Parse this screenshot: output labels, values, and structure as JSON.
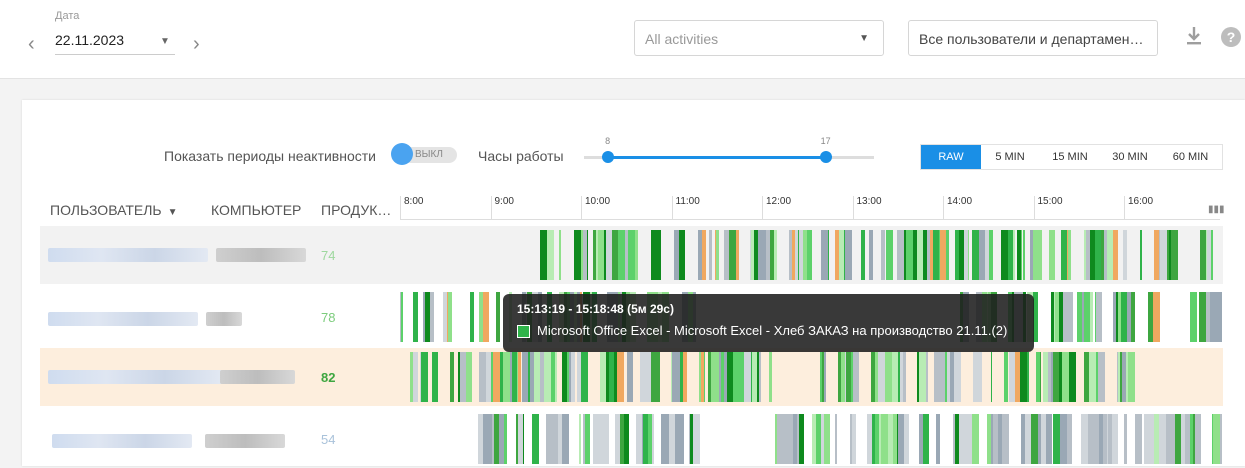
{
  "date": {
    "label": "Дата",
    "value": "22.11.2023",
    "prev_icon": "chevron-left-icon",
    "next_icon": "chevron-right-icon"
  },
  "filters": {
    "activities": "All activities",
    "users": "Все пользователи и департамен…"
  },
  "toolbar": {
    "download_icon": "download-icon",
    "help_icon": "help-icon",
    "help_glyph": "?"
  },
  "controls": {
    "inactivity_label": "Показать периоды неактивности",
    "inactivity_toggle": "ВЫКЛ",
    "work_hours_label": "Часы работы",
    "work_hours_start": "8",
    "work_hours_end": "17",
    "work_hours_min": 7,
    "work_hours_max": 19,
    "intervals": [
      "RAW",
      "5 MIN",
      "15 MIN",
      "30 MIN",
      "60 MIN"
    ],
    "active_interval": "RAW"
  },
  "table": {
    "columns": {
      "user": "ПОЛЬЗОВАТЕЛЬ",
      "computer": "КОМПЬЮТЕР",
      "productivity": "ПРОДУК…"
    },
    "hours": [
      "8:00",
      "9:00",
      "10:00",
      "11:00",
      "12:00",
      "13:00",
      "14:00",
      "15:00",
      "16:00"
    ],
    "rows": [
      {
        "productivity": "74",
        "color": "#9ed89e"
      },
      {
        "productivity": "78",
        "color": "#7ccc7c"
      },
      {
        "productivity": "82",
        "color": "#3ea640"
      },
      {
        "productivity": "54",
        "color": "#a9c2da"
      }
    ]
  },
  "tooltip": {
    "title": "15:13:19 - 15:18:48 (5м 29с)",
    "text": "Microsoft Office Excel - Microsoft Excel - Хлеб ЗАКАЗ на производство 21.11.(2)"
  },
  "colors": {
    "accent": "#1a8fe6",
    "productive_dark": "#0e8a1e",
    "productive_light": "#8fe08a",
    "neutral": "#b7bfc7",
    "distracting": "#f0a860"
  }
}
